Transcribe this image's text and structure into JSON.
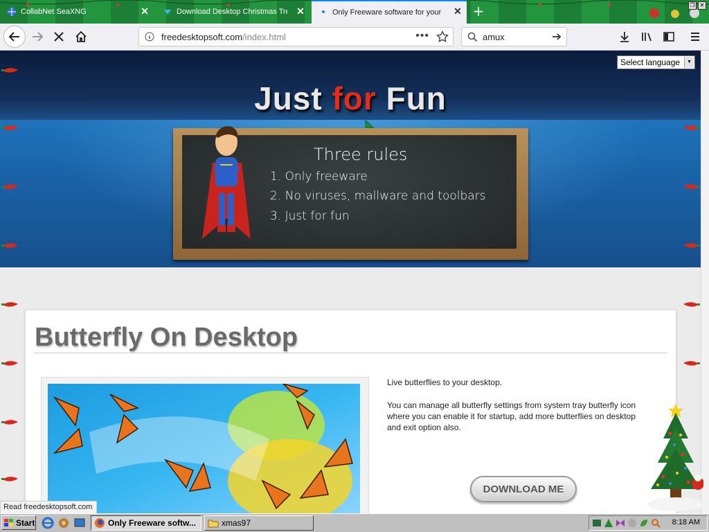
{
  "browser": {
    "tabs": [
      {
        "label": "CollabNet SeaXNG",
        "active": false
      },
      {
        "label": "Download Desktop Christmas Tree",
        "active": false
      },
      {
        "label": "Only Freeware software for your desktop",
        "active": true
      }
    ],
    "url": {
      "domain": "freedesktopsoft.com",
      "path": "/index.html"
    },
    "search_value": "amux",
    "page_actions": "•••"
  },
  "page": {
    "language_select": "Select language",
    "hero": {
      "title_part1": "Just ",
      "title_part2": "for",
      "title_part3": " Fun",
      "board_title": "Three rules",
      "rules": [
        "1. Only freeware",
        "2. No viruses, mallware and toolbars",
        "3. Just for fun"
      ]
    },
    "product": {
      "title": "Butterfly On Desktop",
      "description_short": "Live butterflies to your desktop.",
      "description_long": "You can manage all butterfly settings from system tray butterfly icon where you can enable it for startup, add more butterflies on desktop and exit option also.",
      "download_label": "DOWNLOAD ME"
    },
    "status_link": "Read freedesktopsoft.com"
  },
  "taskbar": {
    "start_label": "Start",
    "tasks": [
      {
        "label": "Only Freeware softw...",
        "active": true
      },
      {
        "label": "xmas97",
        "active": false
      }
    ],
    "clock": "8:18 AM"
  },
  "colors": {
    "tabstrip": "#1f8a3a",
    "accent_red": "#e22d1c",
    "hero_blue": "#1a62a6",
    "board": "#2d3232"
  }
}
